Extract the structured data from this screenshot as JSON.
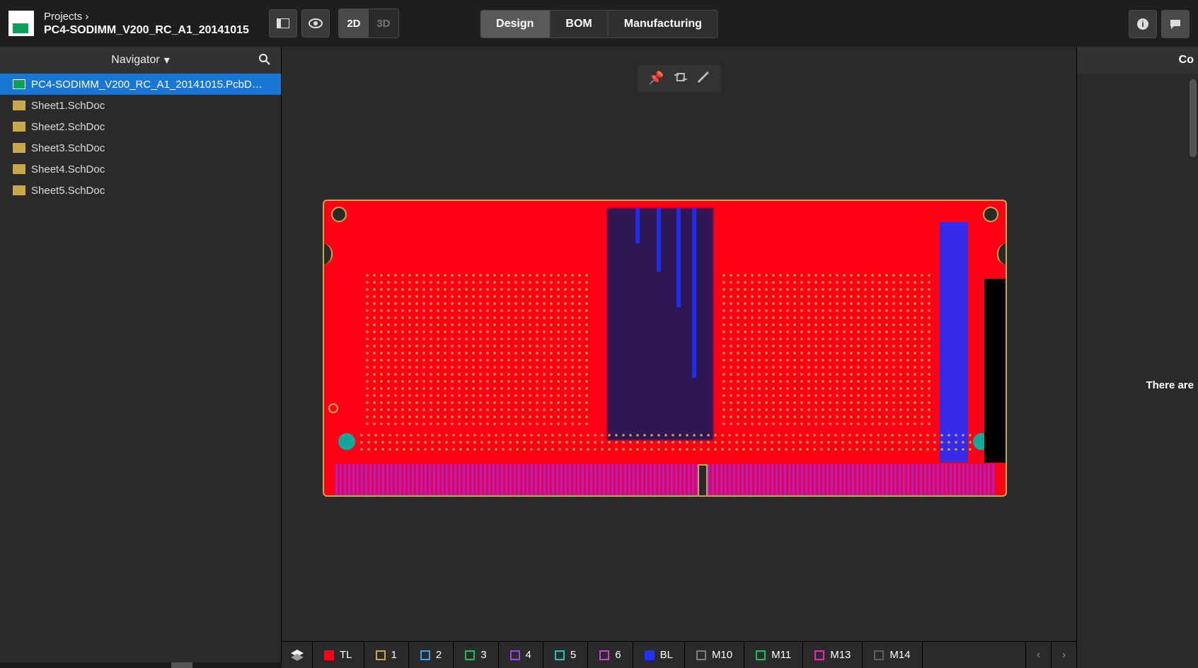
{
  "breadcrumb": {
    "parent": "Projects ›",
    "current": "PC4-SODIMM_V200_RC_A1_20141015"
  },
  "toolbar": {
    "view2d": "2D",
    "view3d": "3D"
  },
  "tabs": {
    "design": "Design",
    "bom": "BOM",
    "manufacturing": "Manufacturing"
  },
  "sidebar": {
    "title": "Navigator",
    "items": [
      {
        "label": "PC4-SODIMM_V200_RC_A1_20141015.PcbD…",
        "type": "pcb",
        "selected": true
      },
      {
        "label": "Sheet1.SchDoc",
        "type": "sch",
        "selected": false
      },
      {
        "label": "Sheet2.SchDoc",
        "type": "sch",
        "selected": false
      },
      {
        "label": "Sheet3.SchDoc",
        "type": "sch",
        "selected": false
      },
      {
        "label": "Sheet4.SchDoc",
        "type": "sch",
        "selected": false
      },
      {
        "label": "Sheet5.SchDoc",
        "type": "sch",
        "selected": false
      }
    ]
  },
  "rightpanel": {
    "header": "Co",
    "message": "There are"
  },
  "layers": [
    {
      "label": "TL",
      "color": "#ff0016",
      "filled": true
    },
    {
      "label": "1",
      "color": "#c9a84a",
      "filled": false
    },
    {
      "label": "2",
      "color": "#3aa0ff",
      "filled": false
    },
    {
      "label": "3",
      "color": "#18c060",
      "filled": false
    },
    {
      "label": "4",
      "color": "#a040ff",
      "filled": false
    },
    {
      "label": "5",
      "color": "#14c8c8",
      "filled": false
    },
    {
      "label": "6",
      "color": "#d040d0",
      "filled": false
    },
    {
      "label": "BL",
      "color": "#2030ff",
      "filled": true
    },
    {
      "label": "M10",
      "color": "#808080",
      "filled": false
    },
    {
      "label": "M11",
      "color": "#18c060",
      "filled": false
    },
    {
      "label": "M13",
      "color": "#ff20c0",
      "filled": false
    },
    {
      "label": "M14",
      "color": "#606060",
      "filled": false
    }
  ]
}
